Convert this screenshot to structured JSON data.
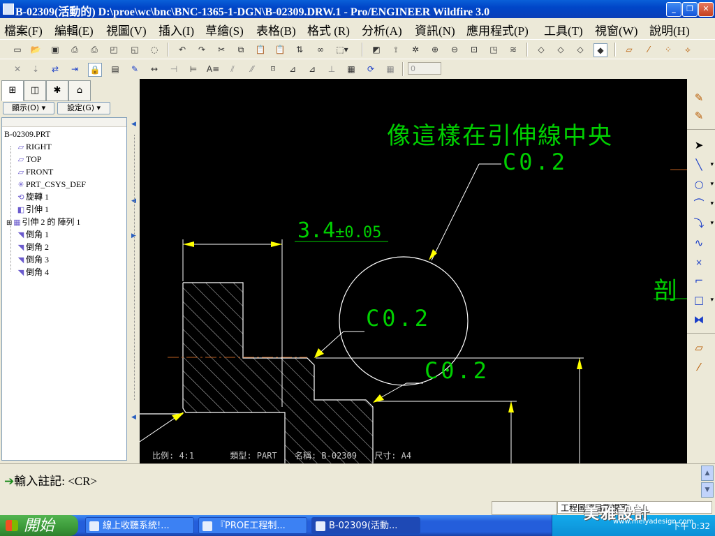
{
  "window": {
    "title": "B-02309(活動的) D:\\proe\\wc\\bnc\\BNC-1365-1-DGN\\B-02309.DRW.1 - Pro/ENGINEER Wildfire 3.0",
    "buttons": [
      "_",
      "❐",
      "✕"
    ]
  },
  "menubar": {
    "items": [
      "檔案(F)",
      "編輯(E)",
      "視圖(V)",
      "插入(I)",
      "草繪(S)",
      "表格(B)",
      "格式 (R)",
      "分析(A)",
      "資訊(N)",
      "應用程式(P)",
      "工具(T)",
      "視窗(W)",
      "說明(H)"
    ]
  },
  "toolbar": {
    "row1_icons": [
      "new-icon",
      "open-icon",
      "save-icon",
      "print-icon",
      "print-preview-icon",
      "copy-file-icon",
      "regen-icon",
      "erase-icon",
      "undo-icon",
      "redo-icon",
      "cut-icon",
      "copy-icon",
      "paste-icon",
      "paste-special-icon",
      "relations-icon",
      "binoculars-icon",
      "select-box-icon",
      "repaint-icon",
      "spin-center-icon",
      "orient-icon",
      "zoom-in-icon",
      "zoom-out-icon",
      "refit-icon",
      "saved-views-icon",
      "layers-icon",
      "wireframe-icon",
      "hidden-line-icon",
      "no-hidden-icon",
      "shading-icon",
      "datum-planes-icon",
      "datum-axes-icon",
      "datum-points-icon",
      "csys-icon"
    ],
    "row2_icons": [
      "delete-icon",
      "move-icon",
      "swap-icon",
      "align-icon",
      "lock-view-icon",
      "table-icon",
      "show-annotations-icon",
      "dimension-icon",
      "ordinate-icon",
      "baseline-icon",
      "note-icon",
      "leader-icon",
      "surface-finish-icon",
      "balloon-icon",
      "symbol-icon",
      "datum-target-icon",
      "geo-tolerance-icon",
      "table-rows-icon",
      "update-table-icon",
      "repeat-region-icon"
    ],
    "spinner_value": "0"
  },
  "left_panel": {
    "tabs": [
      "model-tree-tab",
      "layer-tab",
      "favorites-tab",
      "web-tab"
    ],
    "dropdown_show": "顯示(O) ▾",
    "dropdown_settings": "設定(G) ▾",
    "tree": [
      {
        "icon": "part-icon",
        "label": "B-02309.PRT",
        "indent": 0
      },
      {
        "icon": "datum-plane-icon",
        "label": "RIGHT",
        "indent": 1
      },
      {
        "icon": "datum-plane-icon",
        "label": "TOP",
        "indent": 1
      },
      {
        "icon": "datum-plane-icon",
        "label": "FRONT",
        "indent": 1
      },
      {
        "icon": "csys-icon",
        "label": "PRT_CSYS_DEF",
        "indent": 1
      },
      {
        "icon": "revolve-icon",
        "label": "旋轉 1",
        "indent": 1
      },
      {
        "icon": "extrude-icon",
        "label": "引伸 1",
        "indent": 1
      },
      {
        "icon": "pattern-icon",
        "label": "引伸 2 的 陣列 1",
        "indent": 1
      },
      {
        "icon": "chamfer-icon",
        "label": "倒角 1",
        "indent": 1
      },
      {
        "icon": "chamfer-icon",
        "label": "倒角 2",
        "indent": 1
      },
      {
        "icon": "chamfer-icon",
        "label": "倒角 3",
        "indent": 1
      },
      {
        "icon": "chamfer-icon",
        "label": "倒角 4",
        "indent": 1
      }
    ]
  },
  "canvas": {
    "heading_note": "像這樣在引伸線中央",
    "note_c02_top": "C0.2",
    "note_c02_mid": "C0.2",
    "note_c02_right": "C0.2",
    "dimension_main": "3.4",
    "dimension_tol": "±0.05",
    "section_label": "剖",
    "title_block": {
      "scale": "比例: 4:1",
      "type": "類型: PART",
      "name": "名稱: B-02309",
      "size": "尺寸: A4"
    },
    "colors": {
      "background": "#000000",
      "annotation": "#00d000",
      "geometry": "#ffffff",
      "arrow": "#ffff00",
      "centerline": "#c06020"
    }
  },
  "right_toolbar": {
    "icons": [
      "sketch-tools-icon",
      "select-arrow-icon",
      "line-icon",
      "circle-icon",
      "arc-icon",
      "fillet-icon",
      "spline-icon",
      "point-icon",
      "chamfer-line-icon",
      "rectangle-icon",
      "mirror-icon",
      "offset-icon",
      "construction-line-icon"
    ]
  },
  "message_area": {
    "prompt": "輸入註記:  <CR>"
  },
  "statusbar": {
    "filter_label": "工程圖項目及視圖"
  },
  "taskbar": {
    "start": "開始",
    "tasks": [
      "線上收聽系統!...",
      "『PROE工程制...",
      "B-02309(活動..."
    ],
    "clock": "下午 0:32"
  },
  "watermark": {
    "text": "美雅設計",
    "url": "www.meiyadesign.com"
  }
}
